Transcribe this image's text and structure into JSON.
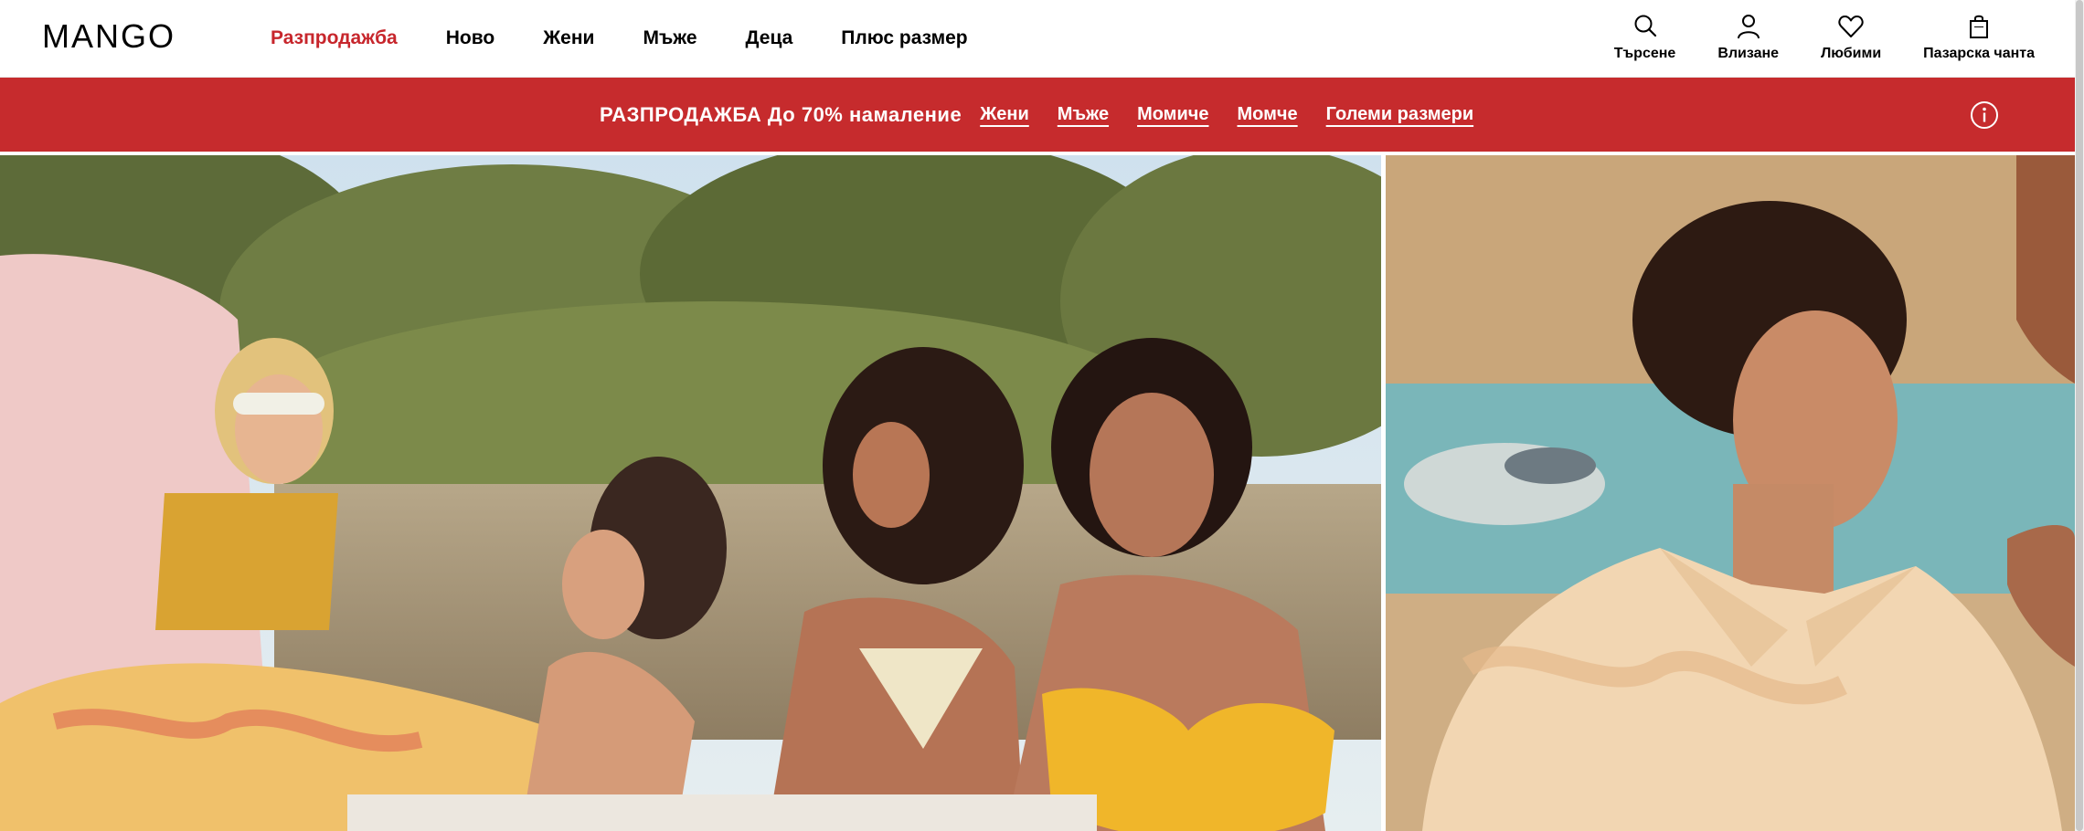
{
  "brand": {
    "logo_text": "MANGO"
  },
  "nav": {
    "items": [
      {
        "label": "Разпродажба"
      },
      {
        "label": "Ново"
      },
      {
        "label": "Жени"
      },
      {
        "label": "Мъже"
      },
      {
        "label": "Деца"
      },
      {
        "label": "Плюс размер"
      }
    ]
  },
  "actions": {
    "search": {
      "label": "Търсене",
      "icon": "search-icon"
    },
    "login": {
      "label": "Влизане",
      "icon": "user-icon"
    },
    "favorites": {
      "label": "Любими",
      "icon": "heart-icon"
    },
    "bag": {
      "label": "Пазарска чанта",
      "icon": "shopping-bag-icon"
    }
  },
  "promo": {
    "text": "РАЗПРОДАЖБА До 70% намаление",
    "links": [
      {
        "label": "Жени"
      },
      {
        "label": "Мъже"
      },
      {
        "label": "Момиче"
      },
      {
        "label": "Момче"
      },
      {
        "label": "Големи размери"
      }
    ],
    "info_icon": "info-icon"
  },
  "colors": {
    "sale_accent": "#c7262c",
    "promo_bg": "#c62b2d",
    "text": "#000000"
  }
}
